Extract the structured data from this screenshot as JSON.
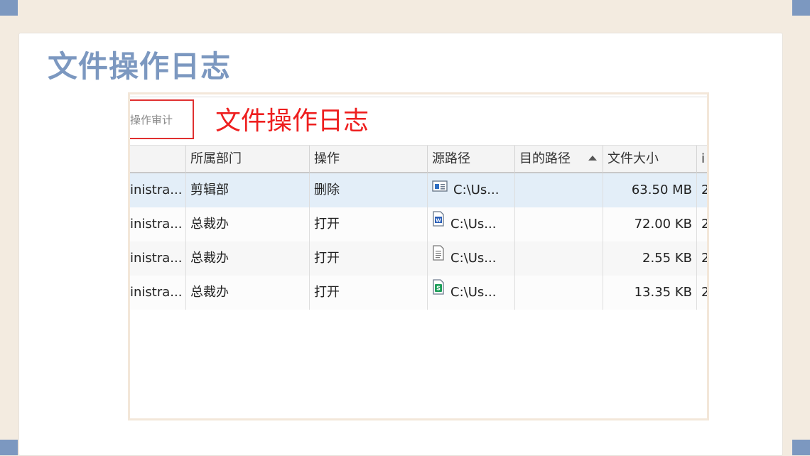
{
  "slide": {
    "title": "文件操作日志"
  },
  "screenshot": {
    "tab_label": "操作审计",
    "big_label": "文件操作日志",
    "columns": [
      "",
      "所属部门",
      "操作",
      "源路径",
      "目的路径",
      "文件大小",
      "i"
    ],
    "sorted_column": "目的路径",
    "rows": [
      {
        "user": "inistra...",
        "dept": "剪辑部",
        "op": "删除",
        "src": "C:\\Us...",
        "dst": "",
        "size": "63.50 MB",
        "extra": "2",
        "icon": "window-file-icon"
      },
      {
        "user": "inistra...",
        "dept": "总裁办",
        "op": "打开",
        "src": "C:\\Us...",
        "dst": "",
        "size": "72.00 KB",
        "extra": "2",
        "icon": "word-doc-icon"
      },
      {
        "user": "inistra...",
        "dept": "总裁办",
        "op": "打开",
        "src": "C:\\Us...",
        "dst": "",
        "size": "2.55 KB",
        "extra": "2",
        "icon": "text-file-icon"
      },
      {
        "user": "inistra...",
        "dept": "总裁办",
        "op": "打开",
        "src": "C:\\Us...",
        "dst": "",
        "size": "13.35 KB",
        "extra": "2",
        "icon": "spreadsheet-icon"
      }
    ]
  },
  "colors": {
    "accent": "#7c98c0",
    "highlight_red": "#ee1f1f",
    "selected_row": "#e3eef8"
  }
}
